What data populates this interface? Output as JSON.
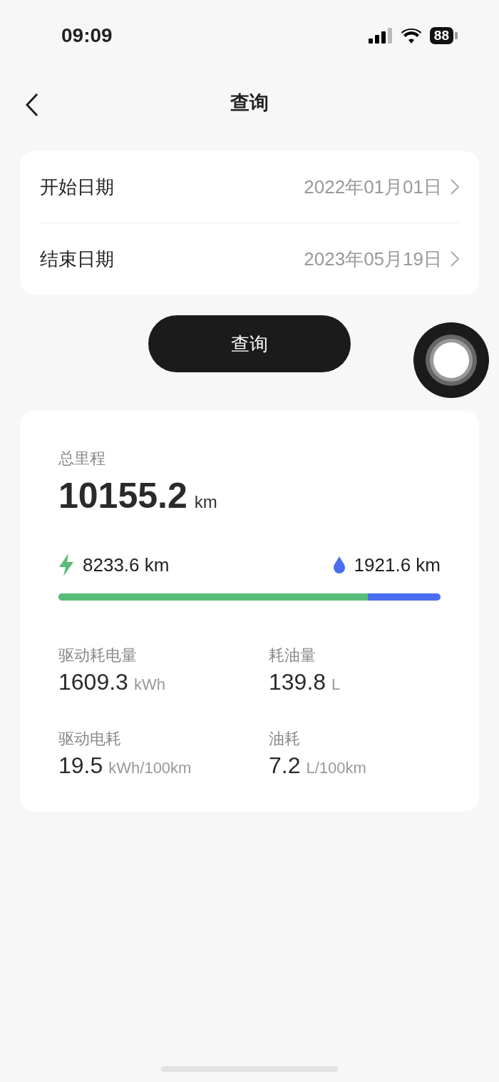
{
  "status_bar": {
    "time": "09:09",
    "battery": "88"
  },
  "nav": {
    "title": "查询"
  },
  "date_rows": [
    {
      "label": "开始日期",
      "value": "2022年01月01日"
    },
    {
      "label": "结束日期",
      "value": "2023年05月19日"
    }
  ],
  "query_button": "查询",
  "summary": {
    "label": "总里程",
    "value": "10155.2",
    "unit": "km",
    "split": {
      "electric": "8233.6 km",
      "fuel": "1921.6 km",
      "level": 0.81
    },
    "metrics": [
      {
        "label": "驱动耗电量",
        "value": "1609.3",
        "unit": "kWh"
      },
      {
        "label": "耗油量",
        "value": "139.8",
        "unit": "L"
      },
      {
        "label": "驱动电耗",
        "value": "19.5",
        "unit": "kWh/100km"
      },
      {
        "label": "油耗",
        "value": "7.2",
        "unit": "L/100km"
      }
    ]
  }
}
